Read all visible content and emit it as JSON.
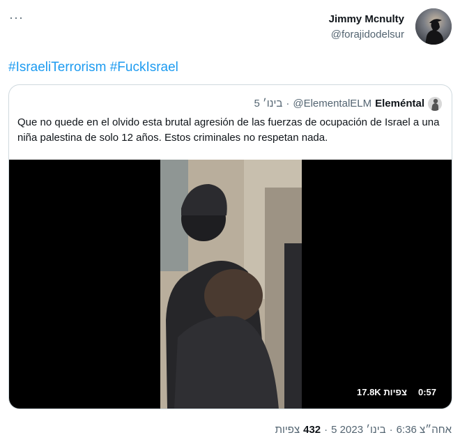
{
  "toolbar": {
    "more_glyph": "···"
  },
  "author": {
    "name": "Jimmy Mcnulty",
    "handle": "@forajidodelsur",
    "avatar_icon": "avatar-silhouette-icon"
  },
  "tweet": {
    "hashtags": [
      "#IsraeliTerrorism",
      "#FuckIsrael"
    ]
  },
  "quote": {
    "name": "Eleméntal",
    "handle": "@ElementalELM",
    "separator": "·",
    "date": "5 בינו׳",
    "text": "Que no quede en el olvido esta brutal agresión de las fuerzas de ocupación de Israel a una niña palestina de solo 12 años. Estos criminales no respetan nada.",
    "media": {
      "type": "video",
      "duration": "0:57",
      "views_label": "17.8K צפיות"
    }
  },
  "footer": {
    "time": "6:36 אחה״צ",
    "separator1": "·",
    "date": "5 בינו׳ 2023",
    "separator2": "·",
    "views_count": "432",
    "views_label": "צפיות"
  },
  "colors": {
    "link": "#1d9bf0",
    "muted": "#536471",
    "text": "#0f1419",
    "border": "#cfd9de"
  }
}
